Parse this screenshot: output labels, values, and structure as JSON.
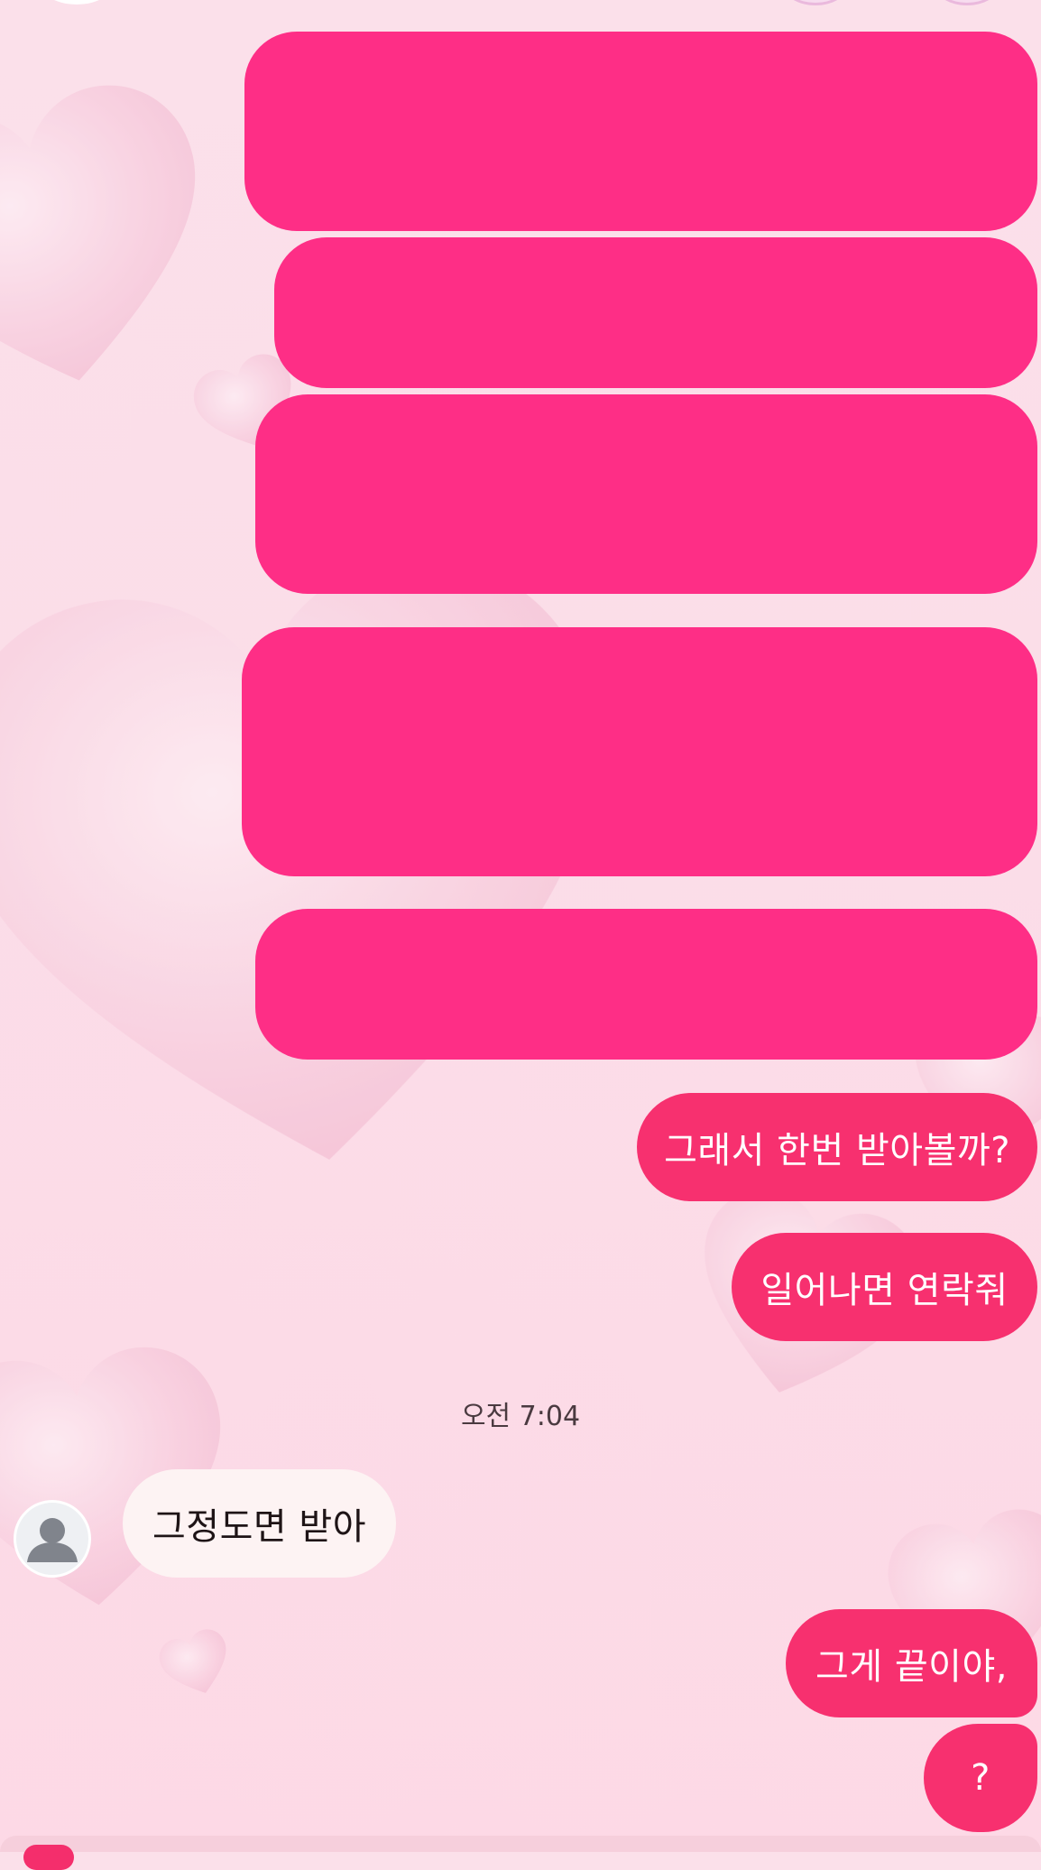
{
  "colors": {
    "sent_bubble": "#f7306f",
    "redacted_bubble": "#fe2e86",
    "received_bubble": "#fdf3f3",
    "background": "#fbdde8"
  },
  "conversation": {
    "sent_messages": [
      "그래서 한번 받아볼까?",
      "일어나면 연락줘"
    ],
    "timestamp": "오전 7:04",
    "received_message": "그정도면 받아",
    "sent_after": [
      "그게 끝이야,",
      "?"
    ]
  },
  "icons": {
    "avatar": "default-person-icon"
  }
}
